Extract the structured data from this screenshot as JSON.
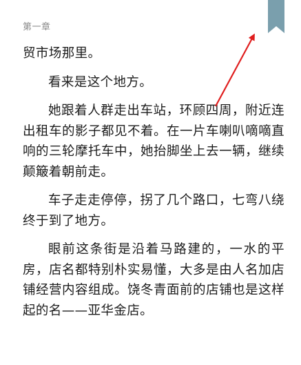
{
  "header": {
    "chapter": "第一章"
  },
  "bookmark": {
    "color": "#7a9fad",
    "icon": "bookmark-ribbon-icon"
  },
  "annotation": {
    "color": "#e01e1e",
    "icon": "red-arrow-icon"
  },
  "content": {
    "paragraphs": [
      "贸市场那里。",
      "看来是这个地方。",
      "她跟着人群走出车站，环顾四周，附近连出租车的影子都见不着。在一片车喇叭嘀嘀直响的三轮摩托车中，她抬脚坐上去一辆，继续颠簸着朝前走。",
      "车子走走停停，拐了几个路口，七弯八绕终于到了地方。",
      "眼前这条街是沿着马路建的，一水的平房，店名都特别朴实易懂，大多是由人名加店铺经营内容组成。饶冬青面前的店铺也是这样起的名——亚华金店。"
    ]
  }
}
